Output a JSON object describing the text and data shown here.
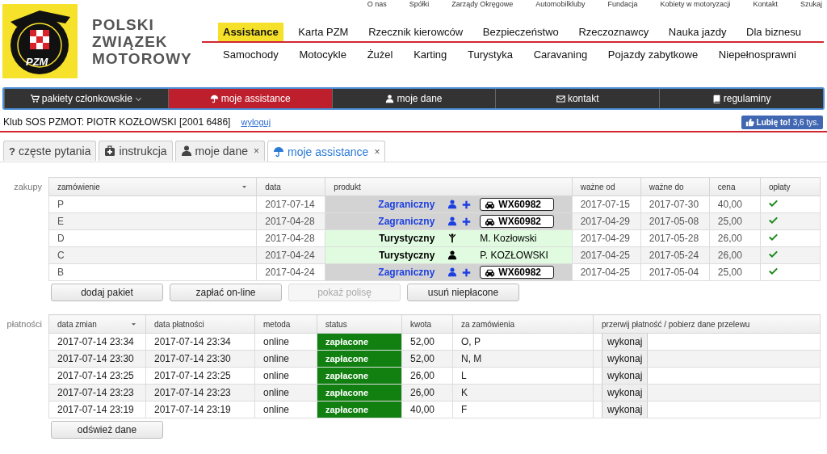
{
  "top_links": [
    "O nas",
    "Spółki",
    "Zarządy Okręgowe",
    "Automobilkluby",
    "Fundacja",
    "Kobiety w motoryzacji",
    "Kontakt",
    "Szukaj"
  ],
  "logo": {
    "text": "PZM"
  },
  "brand": [
    "POLSKI",
    "ZWIĄZEK",
    "MOTOROWY"
  ],
  "main_menu": [
    {
      "label": "Assistance",
      "selected": true
    },
    {
      "label": "Karta PZM",
      "selected": false
    },
    {
      "label": "Rzecznik kierowców",
      "selected": false
    },
    {
      "label": "Bezpieczeństwo",
      "selected": false
    },
    {
      "label": "Rzeczoznawcy",
      "selected": false
    },
    {
      "label": "Nauka jazdy",
      "selected": false
    },
    {
      "label": "Dla biznesu",
      "selected": false
    }
  ],
  "sub_menu": [
    "Samochody",
    "Motocykle",
    "Żużel",
    "Karting",
    "Turystyka",
    "Caravaning",
    "Pojazdy zabytkowe",
    "Niepełnosprawni"
  ],
  "account_nav": [
    {
      "label": "pakiety członkowskie",
      "kind": "cart",
      "dropdown": true,
      "selected": false
    },
    {
      "label": "moje assistance",
      "kind": "umbrella",
      "dropdown": false,
      "selected": true
    },
    {
      "label": "moje dane",
      "kind": "user",
      "dropdown": false,
      "selected": false
    },
    {
      "label": "kontakt",
      "kind": "envelope",
      "dropdown": false,
      "selected": false
    },
    {
      "label": "regulaminy",
      "kind": "book",
      "dropdown": false,
      "selected": false
    }
  ],
  "user_line": {
    "text": "Klub SOS PZMOT: PIOTR KOZŁOWSKI [2001 6486]",
    "logout": "wyloguj"
  },
  "like_button": {
    "label": "Lubię to!",
    "count": "3,6 tys."
  },
  "tabs": [
    {
      "label": "częste pytania",
      "kind": "help",
      "glyph": "?",
      "selected": false
    },
    {
      "label": "instrukcja",
      "kind": "medkit",
      "selected": false
    },
    {
      "label": "moje dane",
      "kind": "user",
      "close": "×",
      "selected": false
    },
    {
      "label": "moje assistance",
      "kind": "umbrella",
      "close": "×",
      "selected": true
    }
  ],
  "orders": {
    "label": "zakupy",
    "columns": [
      {
        "label": "zamówienie",
        "sort": true
      },
      {
        "label": "data",
        "sort": false
      },
      {
        "label": "produkt",
        "sort": false
      },
      {
        "label": "ważne od",
        "sort": false
      },
      {
        "label": "ważne do",
        "sort": false
      },
      {
        "label": "cena",
        "sort": false
      },
      {
        "label": "opłaty",
        "sort": false
      }
    ],
    "rows": [
      {
        "order": "P",
        "date": "2017-07-14",
        "product": {
          "kind": "foreign",
          "name": "Zagraniczny",
          "plate": "WX60982"
        },
        "valid_from": "2017-07-15",
        "valid_to": "2017-07-30",
        "price": "40,00",
        "paid": true
      },
      {
        "order": "E",
        "date": "2017-04-28",
        "product": {
          "kind": "foreign",
          "name": "Zagraniczny",
          "plate": "WX60982"
        },
        "valid_from": "2017-04-29",
        "valid_to": "2017-05-08",
        "price": "25,00",
        "paid": true
      },
      {
        "order": "D",
        "date": "2017-04-28",
        "product": {
          "kind": "tourist_child",
          "name": "Turystyczny",
          "person": "M. Kozłowski"
        },
        "valid_from": "2017-04-29",
        "valid_to": "2017-05-28",
        "price": "26,00",
        "paid": true
      },
      {
        "order": "C",
        "date": "2017-04-24",
        "product": {
          "kind": "tourist_adult",
          "name": "Turystyczny",
          "person": "P. KOZŁOWSKI"
        },
        "valid_from": "2017-04-25",
        "valid_to": "2017-05-24",
        "price": "26,00",
        "paid": true
      },
      {
        "order": "B",
        "date": "2017-04-24",
        "product": {
          "kind": "foreign",
          "name": "Zagraniczny",
          "plate": "WX60982"
        },
        "valid_from": "2017-04-25",
        "valid_to": "2017-05-04",
        "price": "25,00",
        "paid": true
      }
    ],
    "buttons": [
      {
        "label": "dodaj pakiet",
        "disabled": false
      },
      {
        "label": "zapłać on-line",
        "disabled": false
      },
      {
        "label": "pokaż polisę",
        "disabled": true
      },
      {
        "label": "usuń niepłacone",
        "disabled": false
      }
    ]
  },
  "payments": {
    "label": "płatności",
    "columns": [
      {
        "label": "data zmian",
        "sort": true
      },
      {
        "label": "data płatności",
        "sort": false
      },
      {
        "label": "metoda",
        "sort": false
      },
      {
        "label": "status",
        "sort": false
      },
      {
        "label": "kwota",
        "sort": false
      },
      {
        "label": "za zamówienia",
        "sort": false
      },
      {
        "label": "przerwij płatność / pobierz dane przelewu",
        "sort": false
      }
    ],
    "rows": [
      {
        "changed": "2017-07-14 23:34",
        "paid_at": "2017-07-14 23:34",
        "method": "online",
        "status": "zapłacone",
        "amount": "52,00",
        "orders": "O, P",
        "action": "wykonaj"
      },
      {
        "changed": "2017-07-14 23:30",
        "paid_at": "2017-07-14 23:30",
        "method": "online",
        "status": "zapłacone",
        "amount": "52,00",
        "orders": "N, M",
        "action": "wykonaj"
      },
      {
        "changed": "2017-07-14 23:25",
        "paid_at": "2017-07-14 23:25",
        "method": "online",
        "status": "zapłacone",
        "amount": "26,00",
        "orders": "L",
        "action": "wykonaj"
      },
      {
        "changed": "2017-07-14 23:23",
        "paid_at": "2017-07-14 23:23",
        "method": "online",
        "status": "zapłacone",
        "amount": "26,00",
        "orders": "K",
        "action": "wykonaj"
      },
      {
        "changed": "2017-07-14 23:19",
        "paid_at": "2017-07-14 23:19",
        "method": "online",
        "status": "zapłacone",
        "amount": "40,00",
        "orders": "F",
        "action": "wykonaj"
      }
    ],
    "refresh_button": "odśwież dane"
  }
}
